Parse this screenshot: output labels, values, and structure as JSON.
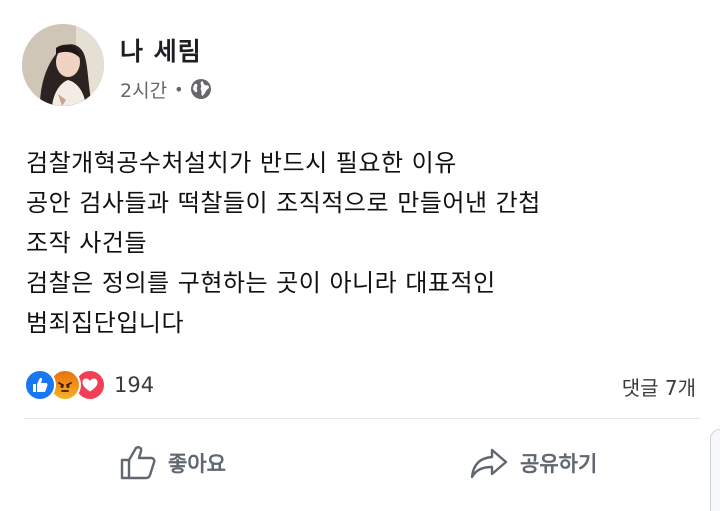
{
  "post": {
    "author": "나 세림",
    "time": "2시간",
    "separator": "•",
    "privacy_icon": "globe-icon",
    "body_lines": [
      "검찰개혁공수처설치가 반드시 필요한 이유",
      "공안 검사들과 떡찰들이 조직적으로 만들어낸 간첩",
      "조작 사건들",
      "검찰은 정의를 구현하는 곳이 아니라 대표적인",
      "범죄집단입니다"
    ]
  },
  "reactions": {
    "icons": [
      "like-icon",
      "angry-icon",
      "love-icon"
    ],
    "count": "194",
    "comments": "댓글 7개"
  },
  "actions": {
    "like_label": "좋아요",
    "share_label": "공유하기"
  },
  "colors": {
    "like_blue": "#1877f2",
    "love_red": "#f33e58",
    "angry_orange": "#e9710f",
    "secondary_text": "#65676b",
    "action_text": "#606770"
  }
}
